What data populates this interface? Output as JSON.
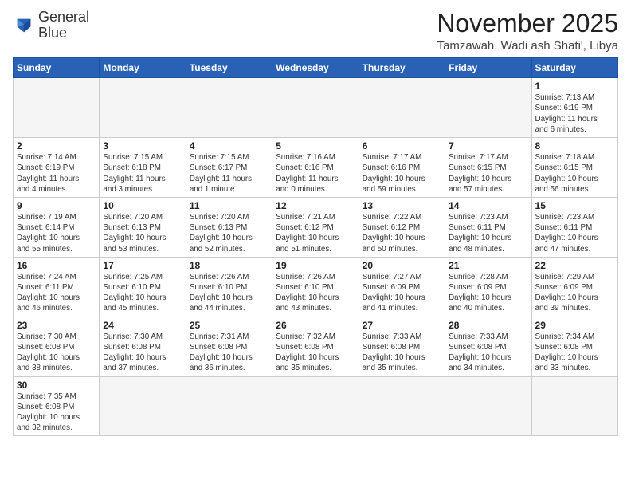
{
  "logo": {
    "line1": "General",
    "line2": "Blue"
  },
  "title": "November 2025",
  "location": "Tamzawah, Wadi ash Shati', Libya",
  "weekdays": [
    "Sunday",
    "Monday",
    "Tuesday",
    "Wednesday",
    "Thursday",
    "Friday",
    "Saturday"
  ],
  "weeks": [
    [
      {
        "day": "",
        "info": ""
      },
      {
        "day": "",
        "info": ""
      },
      {
        "day": "",
        "info": ""
      },
      {
        "day": "",
        "info": ""
      },
      {
        "day": "",
        "info": ""
      },
      {
        "day": "",
        "info": ""
      },
      {
        "day": "1",
        "info": "Sunrise: 7:13 AM\nSunset: 6:19 PM\nDaylight: 11 hours\nand 6 minutes."
      }
    ],
    [
      {
        "day": "2",
        "info": "Sunrise: 7:14 AM\nSunset: 6:19 PM\nDaylight: 11 hours\nand 4 minutes."
      },
      {
        "day": "3",
        "info": "Sunrise: 7:15 AM\nSunset: 6:18 PM\nDaylight: 11 hours\nand 3 minutes."
      },
      {
        "day": "4",
        "info": "Sunrise: 7:15 AM\nSunset: 6:17 PM\nDaylight: 11 hours\nand 1 minute."
      },
      {
        "day": "5",
        "info": "Sunrise: 7:16 AM\nSunset: 6:16 PM\nDaylight: 11 hours\nand 0 minutes."
      },
      {
        "day": "6",
        "info": "Sunrise: 7:17 AM\nSunset: 6:16 PM\nDaylight: 10 hours\nand 59 minutes."
      },
      {
        "day": "7",
        "info": "Sunrise: 7:17 AM\nSunset: 6:15 PM\nDaylight: 10 hours\nand 57 minutes."
      },
      {
        "day": "8",
        "info": "Sunrise: 7:18 AM\nSunset: 6:15 PM\nDaylight: 10 hours\nand 56 minutes."
      }
    ],
    [
      {
        "day": "9",
        "info": "Sunrise: 7:19 AM\nSunset: 6:14 PM\nDaylight: 10 hours\nand 55 minutes."
      },
      {
        "day": "10",
        "info": "Sunrise: 7:20 AM\nSunset: 6:13 PM\nDaylight: 10 hours\nand 53 minutes."
      },
      {
        "day": "11",
        "info": "Sunrise: 7:20 AM\nSunset: 6:13 PM\nDaylight: 10 hours\nand 52 minutes."
      },
      {
        "day": "12",
        "info": "Sunrise: 7:21 AM\nSunset: 6:12 PM\nDaylight: 10 hours\nand 51 minutes."
      },
      {
        "day": "13",
        "info": "Sunrise: 7:22 AM\nSunset: 6:12 PM\nDaylight: 10 hours\nand 50 minutes."
      },
      {
        "day": "14",
        "info": "Sunrise: 7:23 AM\nSunset: 6:11 PM\nDaylight: 10 hours\nand 48 minutes."
      },
      {
        "day": "15",
        "info": "Sunrise: 7:23 AM\nSunset: 6:11 PM\nDaylight: 10 hours\nand 47 minutes."
      }
    ],
    [
      {
        "day": "16",
        "info": "Sunrise: 7:24 AM\nSunset: 6:11 PM\nDaylight: 10 hours\nand 46 minutes."
      },
      {
        "day": "17",
        "info": "Sunrise: 7:25 AM\nSunset: 6:10 PM\nDaylight: 10 hours\nand 45 minutes."
      },
      {
        "day": "18",
        "info": "Sunrise: 7:26 AM\nSunset: 6:10 PM\nDaylight: 10 hours\nand 44 minutes."
      },
      {
        "day": "19",
        "info": "Sunrise: 7:26 AM\nSunset: 6:10 PM\nDaylight: 10 hours\nand 43 minutes."
      },
      {
        "day": "20",
        "info": "Sunrise: 7:27 AM\nSunset: 6:09 PM\nDaylight: 10 hours\nand 41 minutes."
      },
      {
        "day": "21",
        "info": "Sunrise: 7:28 AM\nSunset: 6:09 PM\nDaylight: 10 hours\nand 40 minutes."
      },
      {
        "day": "22",
        "info": "Sunrise: 7:29 AM\nSunset: 6:09 PM\nDaylight: 10 hours\nand 39 minutes."
      }
    ],
    [
      {
        "day": "23",
        "info": "Sunrise: 7:30 AM\nSunset: 6:08 PM\nDaylight: 10 hours\nand 38 minutes."
      },
      {
        "day": "24",
        "info": "Sunrise: 7:30 AM\nSunset: 6:08 PM\nDaylight: 10 hours\nand 37 minutes."
      },
      {
        "day": "25",
        "info": "Sunrise: 7:31 AM\nSunset: 6:08 PM\nDaylight: 10 hours\nand 36 minutes."
      },
      {
        "day": "26",
        "info": "Sunrise: 7:32 AM\nSunset: 6:08 PM\nDaylight: 10 hours\nand 35 minutes."
      },
      {
        "day": "27",
        "info": "Sunrise: 7:33 AM\nSunset: 6:08 PM\nDaylight: 10 hours\nand 35 minutes."
      },
      {
        "day": "28",
        "info": "Sunrise: 7:33 AM\nSunset: 6:08 PM\nDaylight: 10 hours\nand 34 minutes."
      },
      {
        "day": "29",
        "info": "Sunrise: 7:34 AM\nSunset: 6:08 PM\nDaylight: 10 hours\nand 33 minutes."
      }
    ],
    [
      {
        "day": "30",
        "info": "Sunrise: 7:35 AM\nSunset: 6:08 PM\nDaylight: 10 hours\nand 32 minutes."
      },
      {
        "day": "",
        "info": ""
      },
      {
        "day": "",
        "info": ""
      },
      {
        "day": "",
        "info": ""
      },
      {
        "day": "",
        "info": ""
      },
      {
        "day": "",
        "info": ""
      },
      {
        "day": "",
        "info": ""
      }
    ]
  ]
}
